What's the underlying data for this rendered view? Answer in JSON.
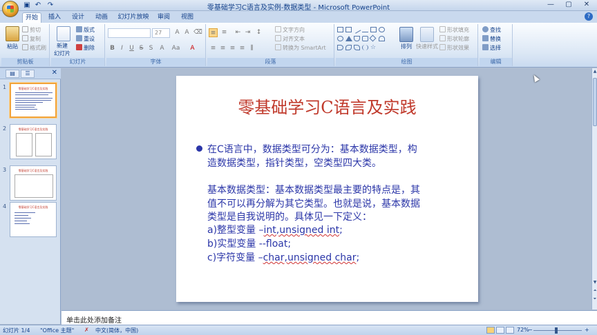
{
  "window": {
    "title": "零基础学习C语言及实例-数据类型 - Microsoft PowerPoint",
    "controls": {
      "minimize": "—",
      "maximize": "▢",
      "close": "✕"
    }
  },
  "quick_access": [
    "save-icon",
    "undo-icon",
    "redo-icon"
  ],
  "tabs": [
    {
      "label": "开始",
      "active": true
    },
    {
      "label": "插入"
    },
    {
      "label": "设计"
    },
    {
      "label": "动画"
    },
    {
      "label": "幻灯片放映"
    },
    {
      "label": "审阅"
    },
    {
      "label": "视图"
    }
  ],
  "ribbon": {
    "clipboard": {
      "label": "剪贴板",
      "paste": "粘贴",
      "cut": "剪切",
      "copy": "复制",
      "format_painter": "格式刷"
    },
    "slides": {
      "label": "幻灯片",
      "new_slide": "新建",
      "new_slide_2": "幻灯片",
      "layout": "版式",
      "reset": "重设",
      "delete": "删除"
    },
    "font": {
      "label": "字体",
      "font_name": "",
      "font_size": "27"
    },
    "paragraph": {
      "label": "段落",
      "text_direction": "文字方向",
      "align_text": "对齐文本",
      "smartart": "转换为 SmartArt"
    },
    "drawing": {
      "label": "绘图",
      "arrange": "排列",
      "quick_styles": "快速样式",
      "shape_fill": "形状填充",
      "shape_outline": "形状轮廓",
      "shape_effects": "形状效果"
    },
    "editing": {
      "label": "编辑",
      "find": "查找",
      "replace": "替换",
      "select": "选择"
    }
  },
  "slides_pane": {
    "thumbnails": [
      {
        "number": "1",
        "selected": true
      },
      {
        "number": "2"
      },
      {
        "number": "3"
      },
      {
        "number": "4"
      }
    ]
  },
  "slide": {
    "title": "零基础学习C语言及实践",
    "bullet_line1": "在C语言中，数据类型可分为：基本数据类型，构",
    "bullet_line2": "造数据类型，指针类型，空类型四大类。",
    "para_line1": "基本数据类型：基本数据类型最主要的特点是，其",
    "para_line2": "值不可以再分解为其它类型。也就是说，基本数据",
    "para_line3": "类型是自我说明的。具体见一下定义：",
    "item_a_prefix": "a)整型变量 –",
    "item_a_code": "int,unsigned int",
    "item_a_suffix": ";",
    "item_b": "b)实型变量 --float;",
    "item_c_prefix": "c)字符变量 –",
    "item_c_code": "char,unsigned char",
    "item_c_suffix": ";"
  },
  "notes": {
    "placeholder": "单击此处添加备注"
  },
  "status_bar": {
    "slide_indicator": "幻灯片 1/4",
    "theme": "\"Office 主题\"",
    "language": "中文(简体，中国)",
    "zoom": "72%"
  }
}
